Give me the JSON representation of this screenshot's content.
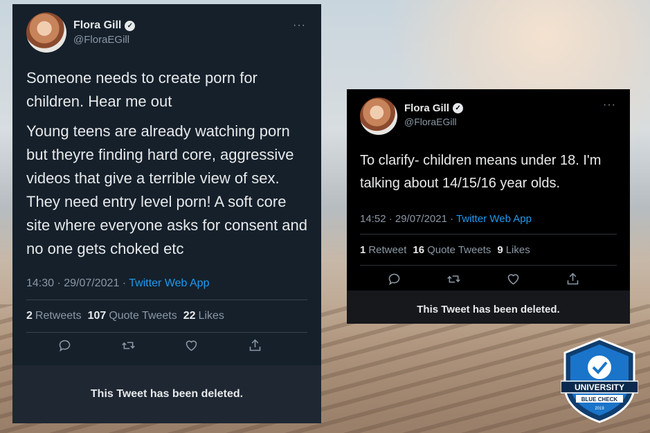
{
  "tweets": [
    {
      "author": {
        "name": "Flora Gill",
        "handle": "@FloraEGill"
      },
      "paragraphs": [
        "Someone needs to create porn for children. Hear me out",
        "Young teens are already watching porn but theyre finding hard core, aggressive videos that give a terrible view of sex. They need entry level porn! A soft core site where everyone asks for consent and no one gets choked etc"
      ],
      "timestamp": "14:30 · 29/07/2021 · ",
      "source": "Twitter Web App",
      "stats": [
        {
          "count": "2",
          "label": "Retweets"
        },
        {
          "count": "107",
          "label": "Quote Tweets"
        },
        {
          "count": "22",
          "label": "Likes"
        }
      ],
      "deleted_notice": "This Tweet has been deleted."
    },
    {
      "author": {
        "name": "Flora Gill",
        "handle": "@FloraEGill"
      },
      "paragraphs": [
        "To clarify- children means under 18. I'm talking about 14/15/16 year olds."
      ],
      "timestamp": "14:52 · 29/07/2021 · ",
      "source": "Twitter Web App",
      "stats": [
        {
          "count": "1",
          "label": "Retweet"
        },
        {
          "count": "16",
          "label": "Quote Tweets"
        },
        {
          "count": "9",
          "label": "Likes"
        }
      ],
      "deleted_notice": "This Tweet has been deleted."
    }
  ],
  "badge": {
    "line1": "UNIVERSITY",
    "line2": "BLUE CHECK",
    "year": "2019"
  },
  "colors": {
    "link": "#1d9bf0",
    "dim_bg": "#15202b",
    "black_bg": "#000000",
    "badge_blue": "#1a74c9"
  },
  "icons": [
    "verified-icon",
    "more-icon",
    "reply-icon",
    "retweet-icon",
    "like-icon",
    "share-icon",
    "shield-check-icon"
  ]
}
